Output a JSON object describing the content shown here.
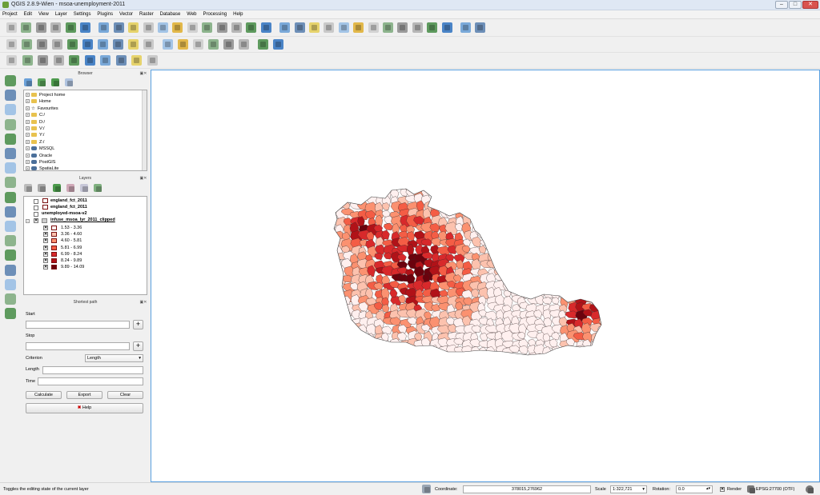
{
  "window": {
    "title": "QGIS 2.8.9-Wien - msoa-unemployment-2011",
    "minimize": "–",
    "maximize": "□",
    "close": "✕"
  },
  "menu": [
    "Project",
    "Edit",
    "View",
    "Layer",
    "Settings",
    "Plugins",
    "Vector",
    "Raster",
    "Database",
    "Web",
    "Processing",
    "Help"
  ],
  "toolbar_icons": {
    "row1": [
      "new-project-icon",
      "open-project-icon",
      "save-project-icon",
      "save-as-icon",
      "new-print-composer-icon",
      "composer-manager-icon",
      "touch-zoom-icon",
      "pan-map-icon",
      "pan-to-selection-icon",
      "zoom-in-icon",
      "zoom-out-icon",
      "zoom-actual-size-icon",
      "zoom-full-icon",
      "zoom-to-selection-icon",
      "zoom-to-layer-icon",
      "zoom-last-icon",
      "zoom-next-icon",
      "refresh-icon",
      "identify-icon",
      "run-feature-action-icon",
      "select-features-icon",
      "deselect-icon",
      "field-calculator-icon",
      "attribute-table-icon",
      "statistics-icon",
      "measure-icon",
      "map-tips-icon",
      "new-bookmark-icon",
      "show-bookmarks-icon",
      "text-annotation-icon",
      "whats-this-icon",
      "help-contents-icon"
    ],
    "row2": [
      "current-edits-icon",
      "toggle-editing-icon",
      "save-edits-icon",
      "add-feature-icon",
      "move-feature-icon",
      "node-tool-icon",
      "delete-selected-icon",
      "cut-features-icon",
      "copy-features-icon",
      "paste-features-icon",
      "label-icon",
      "pin-labels-icon",
      "show-hide-labels-icon",
      "move-label-icon",
      "rotate-label-icon",
      "change-label-icon",
      "csv-icon",
      "python-console-icon"
    ],
    "row3": [
      "add-vector-layer-icon",
      "add-raster-layer-icon",
      "add-postgis-layer-icon",
      "add-spatialite-layer-icon",
      "add-mssql-layer-icon",
      "add-oracle-layer-icon",
      "add-wms-layer-icon",
      "add-wcs-layer-icon",
      "add-wfs-layer-icon",
      "new-shapefile-icon"
    ]
  },
  "browser": {
    "title": "Browser",
    "items": [
      {
        "label": "Project home",
        "icon": "folder-icon"
      },
      {
        "label": "Home",
        "icon": "folder-icon"
      },
      {
        "label": "Favourites",
        "icon": "star-icon"
      },
      {
        "label": "C:/",
        "icon": "folder-icon"
      },
      {
        "label": "D:/",
        "icon": "folder-icon"
      },
      {
        "label": "V:/",
        "icon": "folder-icon"
      },
      {
        "label": "Y:/",
        "icon": "folder-icon"
      },
      {
        "label": "Z:/",
        "icon": "folder-icon"
      },
      {
        "label": "MSSQL",
        "icon": "mssql-icon"
      },
      {
        "label": "Oracle",
        "icon": "oracle-icon"
      },
      {
        "label": "PostGIS",
        "icon": "postgis-icon"
      },
      {
        "label": "SpatiaLite",
        "icon": "spatialite-icon"
      }
    ]
  },
  "layers": {
    "title": "Layers",
    "items": [
      {
        "label": "england_fct_2011",
        "bold": true
      },
      {
        "label": "england_fct_2011",
        "bold": true
      },
      {
        "label": "unemployed-msoa-v2",
        "bold": true
      },
      {
        "label": "infuse_msoa_lyr_2011_clipped",
        "bold": true,
        "underline": true
      }
    ],
    "legend": [
      {
        "label": "1.53 - 3.36",
        "color": "#fff0ef"
      },
      {
        "label": "3.36 - 4.60",
        "color": "#fcc2ae"
      },
      {
        "label": "4.60 - 5.81",
        "color": "#fb9170"
      },
      {
        "label": "5.81 - 6.99",
        "color": "#f45d45"
      },
      {
        "label": "6.99 - 8.24",
        "color": "#d8292b"
      },
      {
        "label": "8.24 - 9.89",
        "color": "#b11218"
      },
      {
        "label": "9.89 - 14.09",
        "color": "#6b020d"
      }
    ]
  },
  "shortest_path": {
    "title": "Shortest path",
    "start_label": "Start",
    "stop_label": "Stop",
    "criterion_label": "Criterion",
    "criterion_value": "Length",
    "length_label": "Length",
    "time_label": "Time",
    "calculate": "Calculate",
    "export": "Export",
    "clear": "Clear",
    "help": "Help"
  },
  "status": {
    "message": "Toggles the editing state of the current layer",
    "coordinate_label": "Coordinate:",
    "coordinate_value": "378015,276962",
    "scale_label": "Scale",
    "scale_value": "1:322,721",
    "rotation_label": "Rotation:",
    "rotation_value": "0.0",
    "render_label": "Render",
    "crs": "EPSG:27700 (OTF)"
  },
  "colors": {
    "c0": "#fff0ef",
    "c1": "#fcc2ae",
    "c2": "#fb9170",
    "c3": "#f45d45",
    "c4": "#d8292b",
    "c5": "#b11218",
    "c6": "#6b020d"
  }
}
